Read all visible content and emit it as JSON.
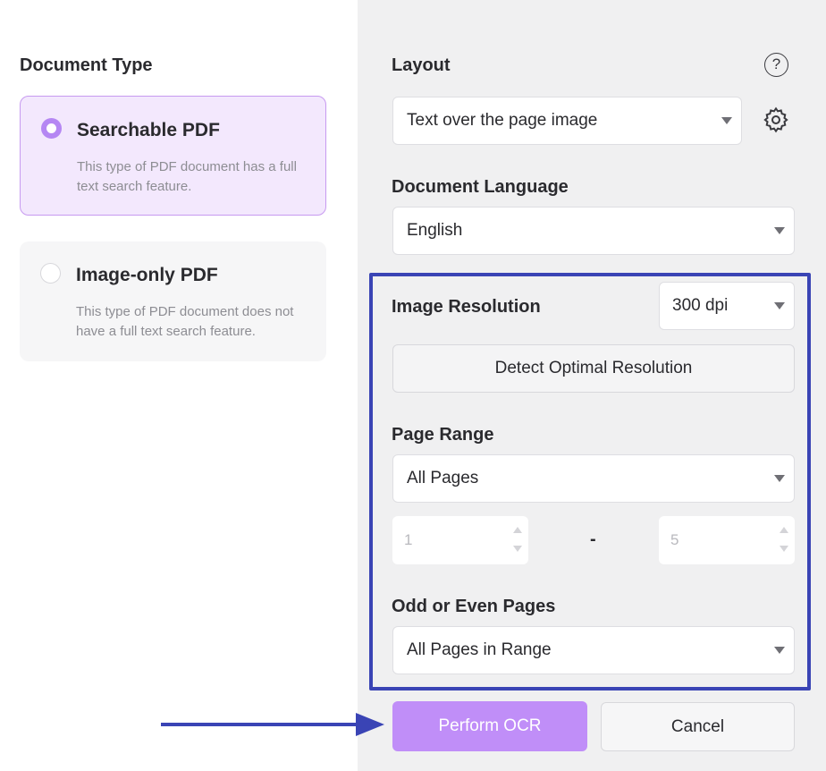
{
  "document_type": {
    "heading": "Document Type",
    "options": [
      {
        "title": "Searchable PDF",
        "description": "This type of PDF document has a full text search feature.",
        "selected": true
      },
      {
        "title": "Image-only PDF",
        "description": "This type of PDF document does not have a full text search feature.",
        "selected": false
      }
    ]
  },
  "layout": {
    "label": "Layout",
    "value": "Text over the page image"
  },
  "language": {
    "label": "Document Language",
    "value": "English"
  },
  "resolution": {
    "label": "Image Resolution",
    "value": "300 dpi",
    "detect_button": "Detect Optimal Resolution"
  },
  "page_range": {
    "label": "Page Range",
    "value": "All Pages",
    "from": "1",
    "separator": "-",
    "to": "5"
  },
  "odd_even": {
    "label": "Odd or Even Pages",
    "value": "All Pages in Range"
  },
  "actions": {
    "perform": "Perform OCR",
    "cancel": "Cancel"
  },
  "colors": {
    "accent": "#c08ef8",
    "highlight": "#3a44b5",
    "selected_card_bg": "#f3e8fd"
  }
}
